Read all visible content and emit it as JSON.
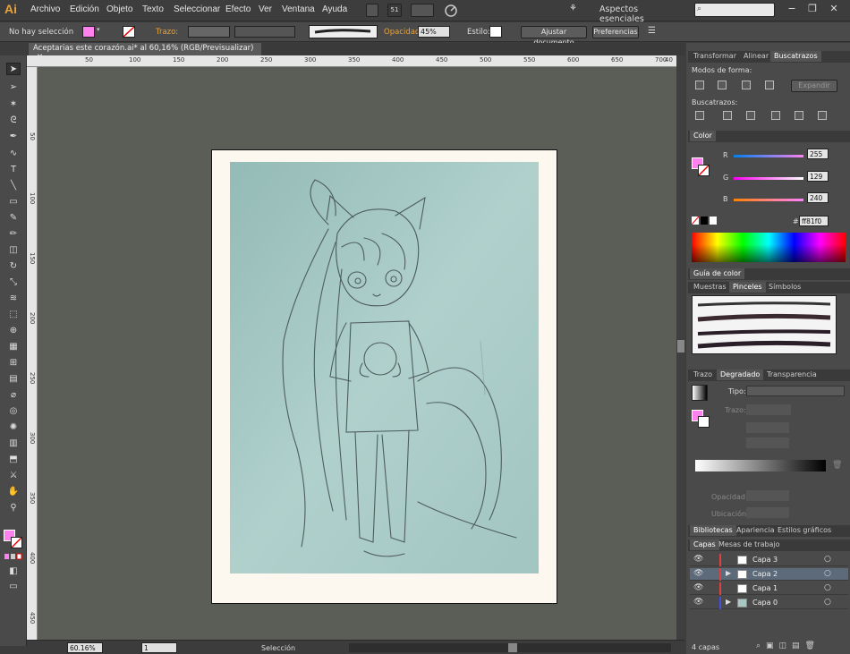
{
  "app": {
    "logo": "Ai"
  },
  "menu": [
    "Archivo",
    "Edición",
    "Objeto",
    "Texto",
    "Seleccionar",
    "Efecto",
    "Ver",
    "Ventana",
    "Ayuda"
  ],
  "menubar_extra": {
    "num_badge": "51",
    "workspace": "Aspectos esenciales"
  },
  "control": {
    "selection": "No hay selección",
    "stroke_label": "Trazo:",
    "opacity_label": "Opacidad:",
    "opacity_value": "45%",
    "style_label": "Estilo:",
    "doc_setup": "Ajustar documento",
    "preferences": "Preferencias"
  },
  "document": {
    "tab_title": "Aceptarias este corazón.ai* al 60,16% (RGB/Previsualizar)"
  },
  "ruler": {
    "h_ticks": [
      "",
      "50",
      "100",
      "150",
      "200",
      "250",
      "300",
      "350",
      "400",
      "450",
      "500",
      "550",
      "600",
      "650",
      "700"
    ],
    "v_ticks": [
      "",
      "50",
      "100",
      "150",
      "200",
      "250",
      "300",
      "350",
      "400",
      "450"
    ],
    "h_last": "40"
  },
  "status": {
    "zoom": "60.16%",
    "page": "1",
    "tool": "Selección"
  },
  "panels": {
    "top_tabs": [
      "Transformar",
      "Alinear",
      "Buscatrazos"
    ],
    "shape_modes": "Modos de forma:",
    "expand": "Expandir",
    "pathfinders": "Buscatrazos:",
    "color_tab": "Color",
    "r_label": "R",
    "g_label": "G",
    "b_label": "B",
    "r_value": "255",
    "g_value": "129",
    "b_value": "240",
    "hex_label": "#",
    "hex_value": "ff81f0",
    "guide_tab": "Guía de color",
    "brush_tabs": [
      "Muestras",
      "Pinceles",
      "Símbolos"
    ],
    "grad_tabs": [
      "Trazo",
      "Degradado",
      "Transparencia"
    ],
    "tipo": "Tipo:",
    "trazo_label": "Trazo:",
    "opacity_label": "Opacidad:",
    "location_label": "Ubicación:",
    "lib_tabs": [
      "Bibliotecas",
      "Apariencia",
      "Estilos gráficos"
    ],
    "layer_tabs": [
      "Capas",
      "Mesas de trabajo"
    ],
    "layers": [
      {
        "name": "Capa 3",
        "color": "#e04040",
        "arrow": false,
        "selected": false
      },
      {
        "name": "Capa 2",
        "color": "#e04040",
        "arrow": true,
        "selected": true
      },
      {
        "name": "Capa 1",
        "color": "#e04040",
        "arrow": false,
        "selected": false
      },
      {
        "name": "Capa 0",
        "color": "#4050e0",
        "arrow": true,
        "selected": false
      }
    ],
    "layer_count": "4 capas"
  },
  "colors": {
    "fill": "#ff81f0",
    "accent": "#e8a33c",
    "photo_bg": "#a6c8c4",
    "canvas": "#5b5e56"
  }
}
